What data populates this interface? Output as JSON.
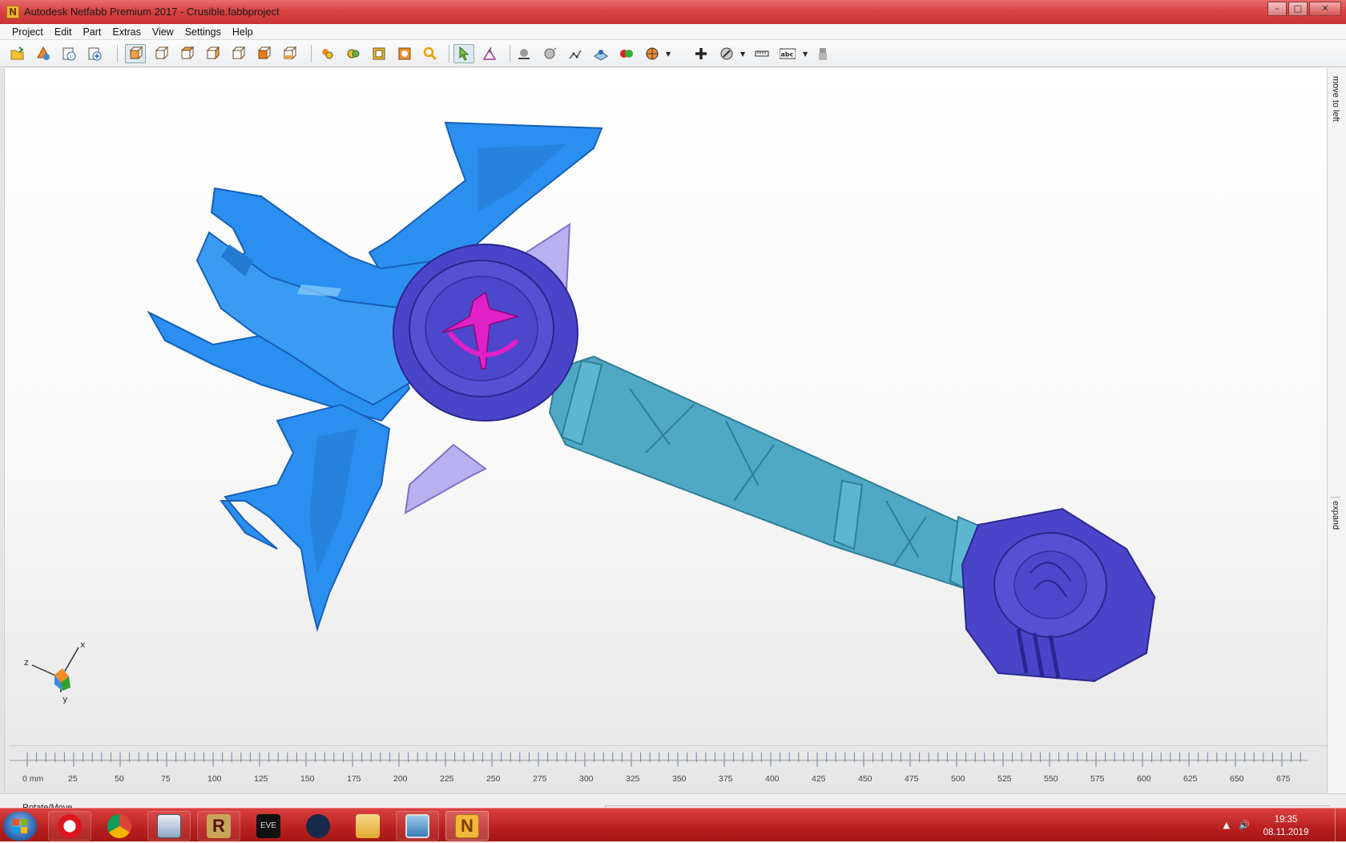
{
  "window": {
    "title": "Autodesk Netfabb Premium 2017 - Crusible.fabbproject",
    "app_icon_letter": "N",
    "controls": {
      "minimize": "–",
      "maximize": "□",
      "close": "✕"
    }
  },
  "menu": [
    "Project",
    "Edit",
    "Part",
    "Extras",
    "View",
    "Settings",
    "Help"
  ],
  "toolbar": {
    "groups": [
      [
        "open-project-icon",
        "add-part-icon",
        "part-info-icon",
        "new-part-icon"
      ],
      [
        "view-default-icon",
        "view-front-icon",
        "view-back-icon",
        "view-left-icon",
        "view-right-icon",
        "view-top-icon",
        "view-bottom-icon"
      ],
      [
        "zoom-all-icon",
        "zoom-selection-icon",
        "zoom-platform-icon",
        "zoom-window-icon",
        "magnifier-icon"
      ],
      [
        "select-cursor-icon",
        "select-triangle-icon"
      ],
      [
        "shade-icon",
        "smooth-icon",
        "points-icon",
        "platform-icon",
        "color-mode-icon",
        "section-icon",
        "add-icon",
        "cutting-icon",
        "ruler-icon",
        "label-icon",
        "support-icon"
      ]
    ],
    "label_button_text": "abc"
  },
  "right_panel": {
    "top_tab": "move to left",
    "mid_tab": "expand"
  },
  "axes": {
    "x": "x",
    "y": "y",
    "z": "z"
  },
  "ruler": {
    "unit_label": "0 mm",
    "ticks": [
      "25",
      "50",
      "75",
      "100",
      "125",
      "150",
      "175",
      "200",
      "225",
      "250",
      "275",
      "300",
      "325",
      "350",
      "375",
      "400",
      "425",
      "450",
      "475",
      "500",
      "525",
      "550",
      "575",
      "600",
      "625",
      "650",
      "675"
    ]
  },
  "status": {
    "text": "Rotate/Move"
  },
  "taskbar": {
    "apps": [
      "opera-icon",
      "chrome-icon",
      "calculator-icon",
      "reaper-icon",
      "eve-icon",
      "atom-app-icon",
      "file-explorer-icon",
      "photo-viewer-icon",
      "netfabb-icon"
    ],
    "eve_label": "EVE",
    "reaper_label": "R",
    "netfabb_label": "N",
    "clock_time": "19:35",
    "clock_date": "08.11.2019"
  },
  "colors": {
    "blade": "#2b8ff0",
    "hilt": "#4a45c8",
    "handle": "#4fa8c4",
    "spike": "#b9b0f0",
    "emblem": "#e020c8"
  }
}
